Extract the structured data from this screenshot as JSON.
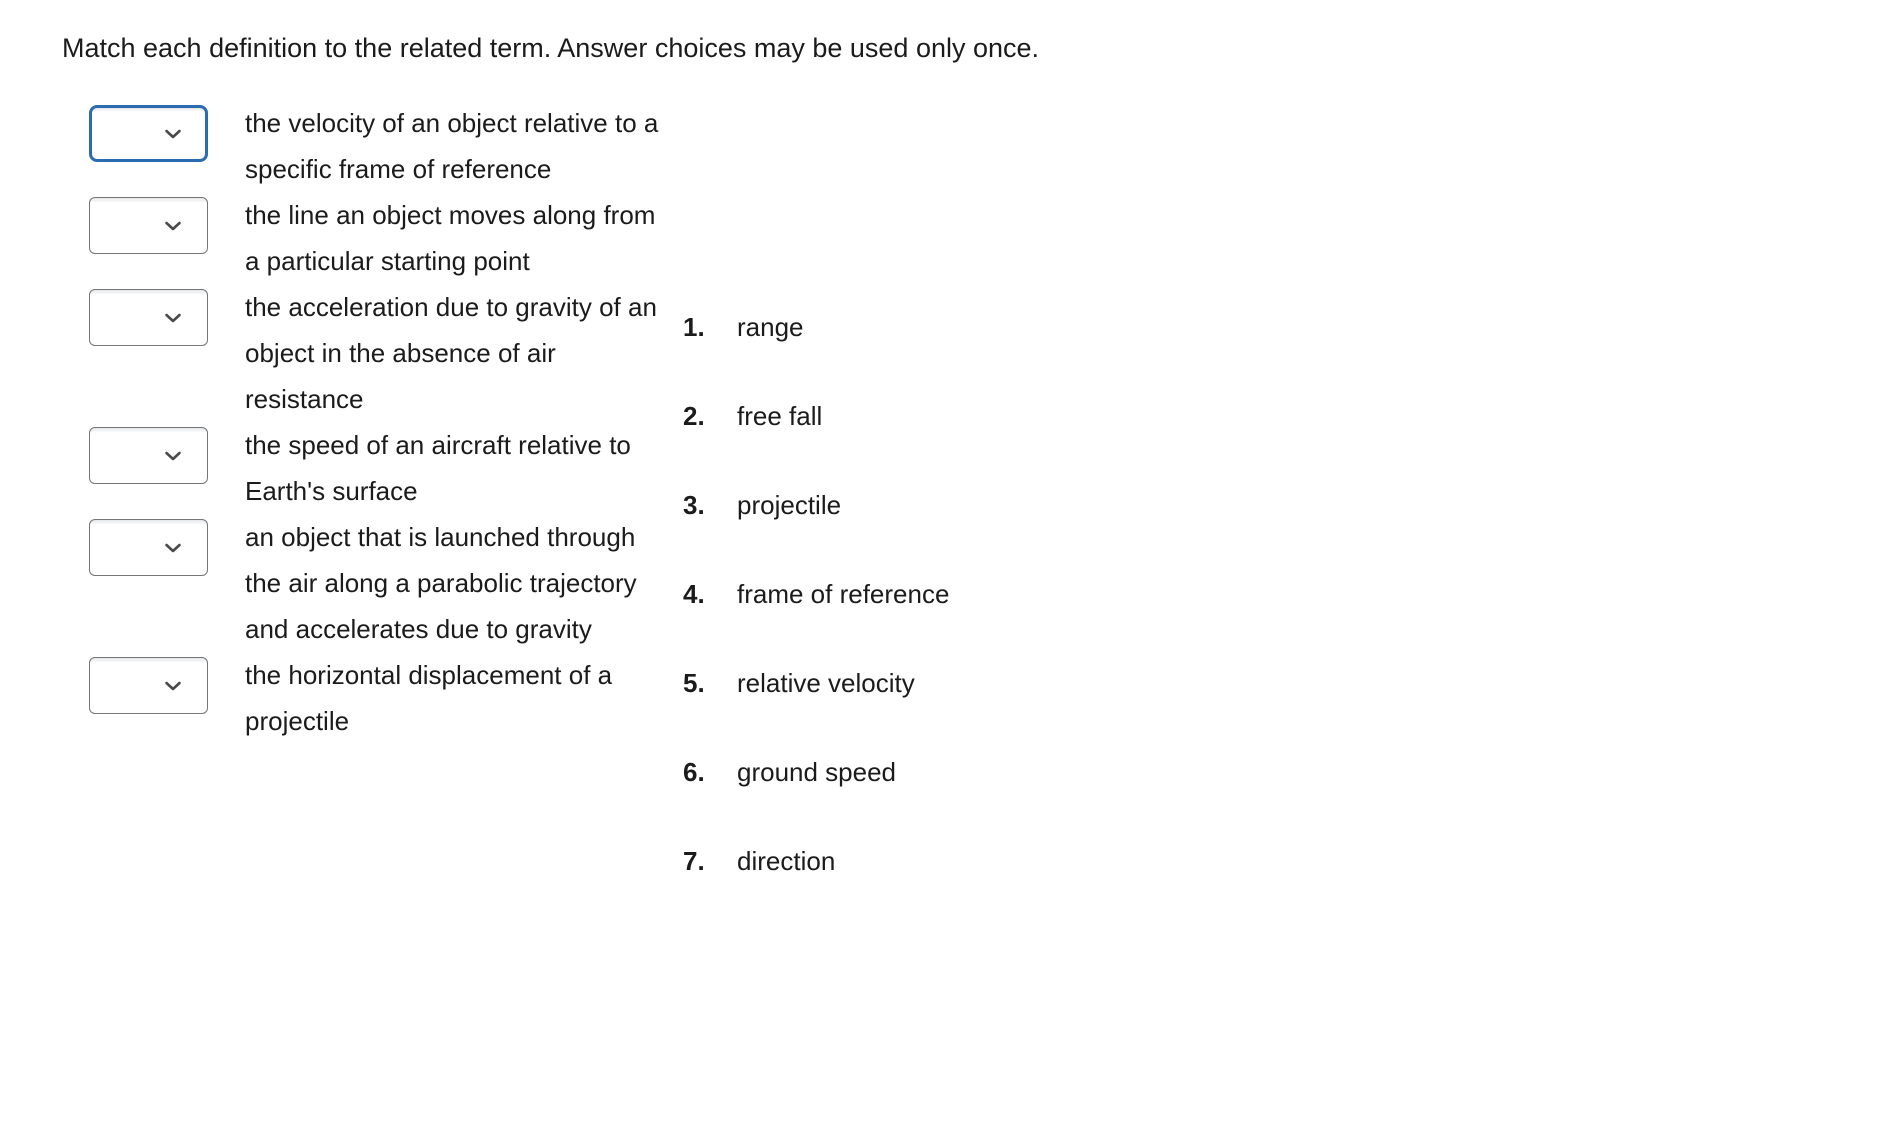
{
  "instruction": "Match each definition to the related term. Answer choices may be used only once.",
  "dropdown": {
    "icon": "chevron-down-icon",
    "selected_value": "",
    "focus_color": "#2b6cb0",
    "border_color": "#767676"
  },
  "definitions": [
    {
      "id": 1,
      "text": "the velocity of an object relative to a specific frame of reference",
      "dropdown_value": "",
      "focused": true
    },
    {
      "id": 2,
      "text": "the line an object moves along from a particular starting point",
      "dropdown_value": "",
      "focused": false
    },
    {
      "id": 3,
      "text": "the acceleration due to gravity of an object in the absence of air resistance",
      "dropdown_value": "",
      "focused": false
    },
    {
      "id": 4,
      "text": "the speed of an aircraft relative to Earth's surface",
      "dropdown_value": "",
      "focused": false
    },
    {
      "id": 5,
      "text": "an object that is launched through the air along a parabolic trajectory and accelerates due to gravity",
      "dropdown_value": "",
      "focused": false
    },
    {
      "id": 6,
      "text": "the horizontal displacement of a projectile",
      "dropdown_value": "",
      "focused": false
    }
  ],
  "answer_choices": [
    {
      "number": "1.",
      "label": "range"
    },
    {
      "number": "2.",
      "label": "free fall"
    },
    {
      "number": "3.",
      "label": "projectile"
    },
    {
      "number": "4.",
      "label": "frame of reference"
    },
    {
      "number": "5.",
      "label": "relative velocity"
    },
    {
      "number": "6.",
      "label": "ground speed"
    },
    {
      "number": "7.",
      "label": "direction"
    }
  ]
}
